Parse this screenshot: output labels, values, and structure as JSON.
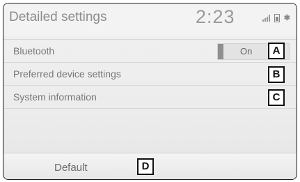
{
  "header": {
    "title": "Detailed settings",
    "clock": "2:23",
    "status_icons": [
      "signal-icon",
      "battery-icon",
      "bluetooth-icon"
    ]
  },
  "rows": [
    {
      "label": "Bluetooth",
      "toggle_value": "On",
      "callout": "A"
    },
    {
      "label": "Preferred device settings",
      "callout": "B"
    },
    {
      "label": "System information",
      "callout": "C"
    }
  ],
  "footer": {
    "default_label": "Default",
    "callout": "D"
  }
}
